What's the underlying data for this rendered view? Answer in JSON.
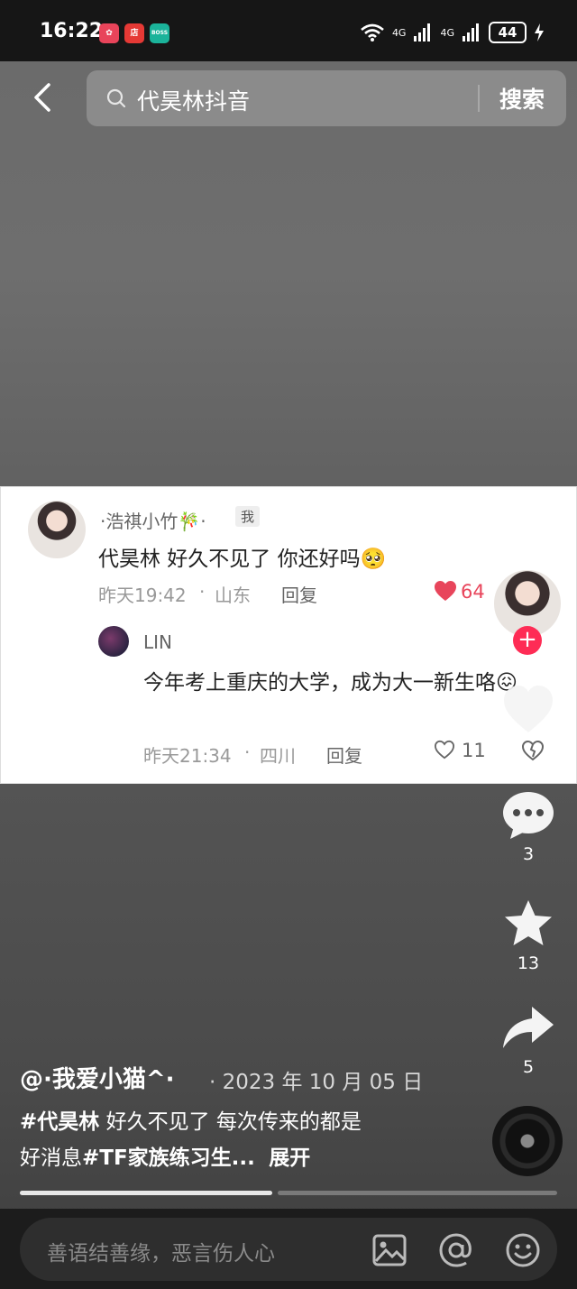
{
  "status_bar": {
    "time": "16:22",
    "net1": "4G",
    "net2": "4G",
    "battery": "44"
  },
  "status_apps": [
    {
      "label": "✿",
      "color": "#e8445a"
    },
    {
      "label": "店",
      "color": "#e53935"
    },
    {
      "label": "BOSS",
      "color": "#1bb39a"
    }
  ],
  "search": {
    "query": "代昊林抖音",
    "button": "搜索"
  },
  "comment": {
    "username": "·浩祺小竹🎋·",
    "me_badge": "我",
    "text": "代昊林 好久不见了 你还好吗🥺",
    "time": "昨天19:42",
    "location": "山东",
    "reply_label": "回复",
    "likes": "64"
  },
  "reply": {
    "username": "LIN",
    "text": "今年考上重庆的大学，成为大一新生咯😖",
    "time": "昨天21:34",
    "location": "四川",
    "reply_label": "回复",
    "likes": "11"
  },
  "sidebar": {
    "comments": "3",
    "favorites": "13",
    "shares": "5"
  },
  "post": {
    "author": "@·我爱小猫^·",
    "date": "· 2023 年 10 月 05 日",
    "hashtag1": "#代昊林",
    "text1": " 好久不见了 每次传来的都是",
    "text2": "好消息",
    "hashtag2": "#TF家族练习生...",
    "expand": "展开"
  },
  "progress": {
    "played": 0.47
  },
  "bottom": {
    "placeholder": "善语结善缘，恶言伤人心"
  },
  "colors": {
    "accent": "#fe2c55",
    "like_red": "#e8455b"
  }
}
